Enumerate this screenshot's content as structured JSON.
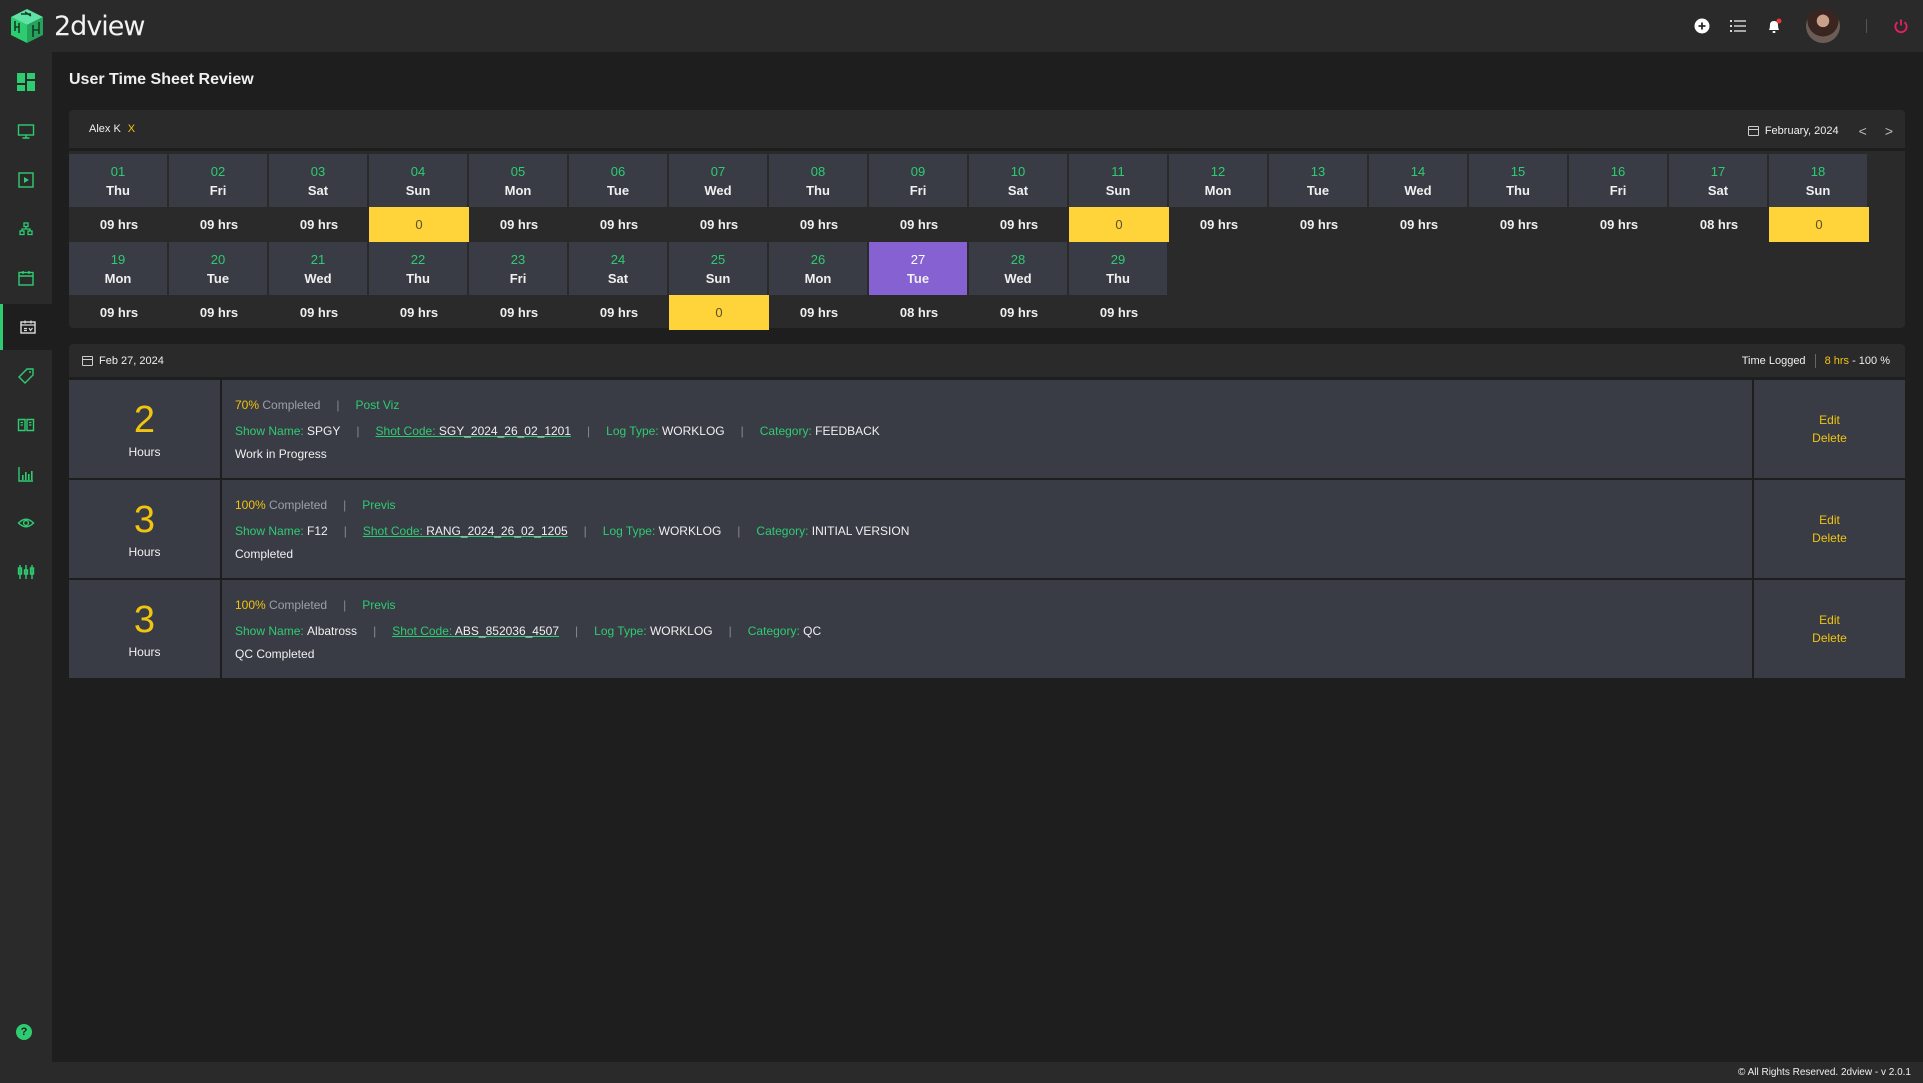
{
  "app": {
    "name": "2dview"
  },
  "header": {
    "icons": [
      "add-circle-icon",
      "list-icon",
      "bell-icon",
      "avatar",
      "power-icon"
    ],
    "has_notification": true
  },
  "sidebar": {
    "items": [
      {
        "name": "dashboard",
        "icon": "dashboard-icon"
      },
      {
        "name": "monitor",
        "icon": "monitor-icon"
      },
      {
        "name": "media",
        "icon": "play-icon"
      },
      {
        "name": "hierarchy",
        "icon": "sitemap-icon"
      },
      {
        "name": "calendar",
        "icon": "calendar-icon"
      },
      {
        "name": "timesheet",
        "icon": "calendar-check-icon",
        "active": true
      },
      {
        "name": "tags",
        "icon": "tags-icon"
      },
      {
        "name": "library",
        "icon": "book-icon"
      },
      {
        "name": "reports",
        "icon": "bar-chart-icon"
      },
      {
        "name": "review",
        "icon": "eye-icon"
      },
      {
        "name": "settings",
        "icon": "sliders-icon"
      }
    ],
    "help": "?"
  },
  "page": {
    "title": "User Time Sheet Review"
  },
  "filter": {
    "user": "Alex K",
    "remove": "X",
    "month": "February, 2024",
    "prev": "<",
    "next": ">"
  },
  "calendar": {
    "days": [
      {
        "num": "01",
        "wd": "Thu",
        "hrs": "09 hrs"
      },
      {
        "num": "02",
        "wd": "Fri",
        "hrs": "09 hrs"
      },
      {
        "num": "03",
        "wd": "Sat",
        "hrs": "09 hrs"
      },
      {
        "num": "04",
        "wd": "Sun",
        "hrs": "0",
        "zero": true
      },
      {
        "num": "05",
        "wd": "Mon",
        "hrs": "09 hrs"
      },
      {
        "num": "06",
        "wd": "Tue",
        "hrs": "09 hrs"
      },
      {
        "num": "07",
        "wd": "Wed",
        "hrs": "09 hrs"
      },
      {
        "num": "08",
        "wd": "Thu",
        "hrs": "09 hrs"
      },
      {
        "num": "09",
        "wd": "Fri",
        "hrs": "09 hrs"
      },
      {
        "num": "10",
        "wd": "Sat",
        "hrs": "09 hrs"
      },
      {
        "num": "11",
        "wd": "Sun",
        "hrs": "0",
        "zero": true
      },
      {
        "num": "12",
        "wd": "Mon",
        "hrs": "09 hrs"
      },
      {
        "num": "13",
        "wd": "Tue",
        "hrs": "09 hrs"
      },
      {
        "num": "14",
        "wd": "Wed",
        "hrs": "09 hrs"
      },
      {
        "num": "15",
        "wd": "Thu",
        "hrs": "09 hrs"
      },
      {
        "num": "16",
        "wd": "Fri",
        "hrs": "09 hrs"
      },
      {
        "num": "17",
        "wd": "Sat",
        "hrs": "08 hrs"
      },
      {
        "num": "18",
        "wd": "Sun",
        "hrs": "0",
        "zero": true
      },
      {
        "num": "19",
        "wd": "Mon",
        "hrs": "09 hrs"
      },
      {
        "num": "20",
        "wd": "Tue",
        "hrs": "09 hrs"
      },
      {
        "num": "21",
        "wd": "Wed",
        "hrs": "09 hrs"
      },
      {
        "num": "22",
        "wd": "Thu",
        "hrs": "09 hrs"
      },
      {
        "num": "23",
        "wd": "Fri",
        "hrs": "09 hrs"
      },
      {
        "num": "24",
        "wd": "Sat",
        "hrs": "09 hrs"
      },
      {
        "num": "25",
        "wd": "Sun",
        "hrs": "0",
        "zero": true
      },
      {
        "num": "26",
        "wd": "Mon",
        "hrs": "09 hrs"
      },
      {
        "num": "27",
        "wd": "Tue",
        "hrs": "08 hrs",
        "selected": true
      },
      {
        "num": "28",
        "wd": "Wed",
        "hrs": "09 hrs"
      },
      {
        "num": "29",
        "wd": "Thu",
        "hrs": "09 hrs"
      }
    ]
  },
  "day_summary": {
    "date": "Feb 27, 2024",
    "time_logged_label": "Time Logged",
    "hours": "8 hrs",
    "percent": " - 100 %"
  },
  "entries": [
    {
      "hours": "2",
      "hours_label": "Hours",
      "percent": "70%",
      "completed_label": " Completed",
      "task": "Post Viz",
      "show_label": "Show Name: ",
      "show": "SPGY",
      "shot_label": "Shot Code: ",
      "shot": "SGY_2024_26_02_1201",
      "logtype_label": "Log Type: ",
      "logtype": "WORKLOG",
      "category_label": "Category: ",
      "category": "FEEDBACK",
      "status": "Work in Progress",
      "edit": "Edit",
      "delete": "Delete"
    },
    {
      "hours": "3",
      "hours_label": "Hours",
      "percent": "100%",
      "completed_label": " Completed",
      "task": "Previs",
      "show_label": "Show Name: ",
      "show": "F12",
      "shot_label": "Shot Code: ",
      "shot": "RANG_2024_26_02_1205",
      "logtype_label": "Log Type: ",
      "logtype": "WORKLOG",
      "category_label": "Category: ",
      "category": "INITIAL VERSION",
      "status": "Completed",
      "edit": "Edit",
      "delete": "Delete"
    },
    {
      "hours": "3",
      "hours_label": "Hours",
      "percent": "100%",
      "completed_label": " Completed",
      "task": "Previs",
      "show_label": "Show Name: ",
      "show": "Albatross",
      "shot_label": "Shot Code: ",
      "shot": "ABS_852036_4507",
      "logtype_label": "Log Type: ",
      "logtype": "WORKLOG",
      "category_label": "Category: ",
      "category": "QC",
      "status": "QC Completed",
      "edit": "Edit",
      "delete": "Delete"
    }
  ],
  "footer": {
    "text": "© All Rights Reserved. 2dview - v 2.0.1"
  },
  "colors": {
    "accent": "#2ecc71",
    "highlight": "#f1c40f",
    "zero_day": "#fed43a",
    "selected_day": "#8661d1",
    "danger": "#e91e63"
  }
}
